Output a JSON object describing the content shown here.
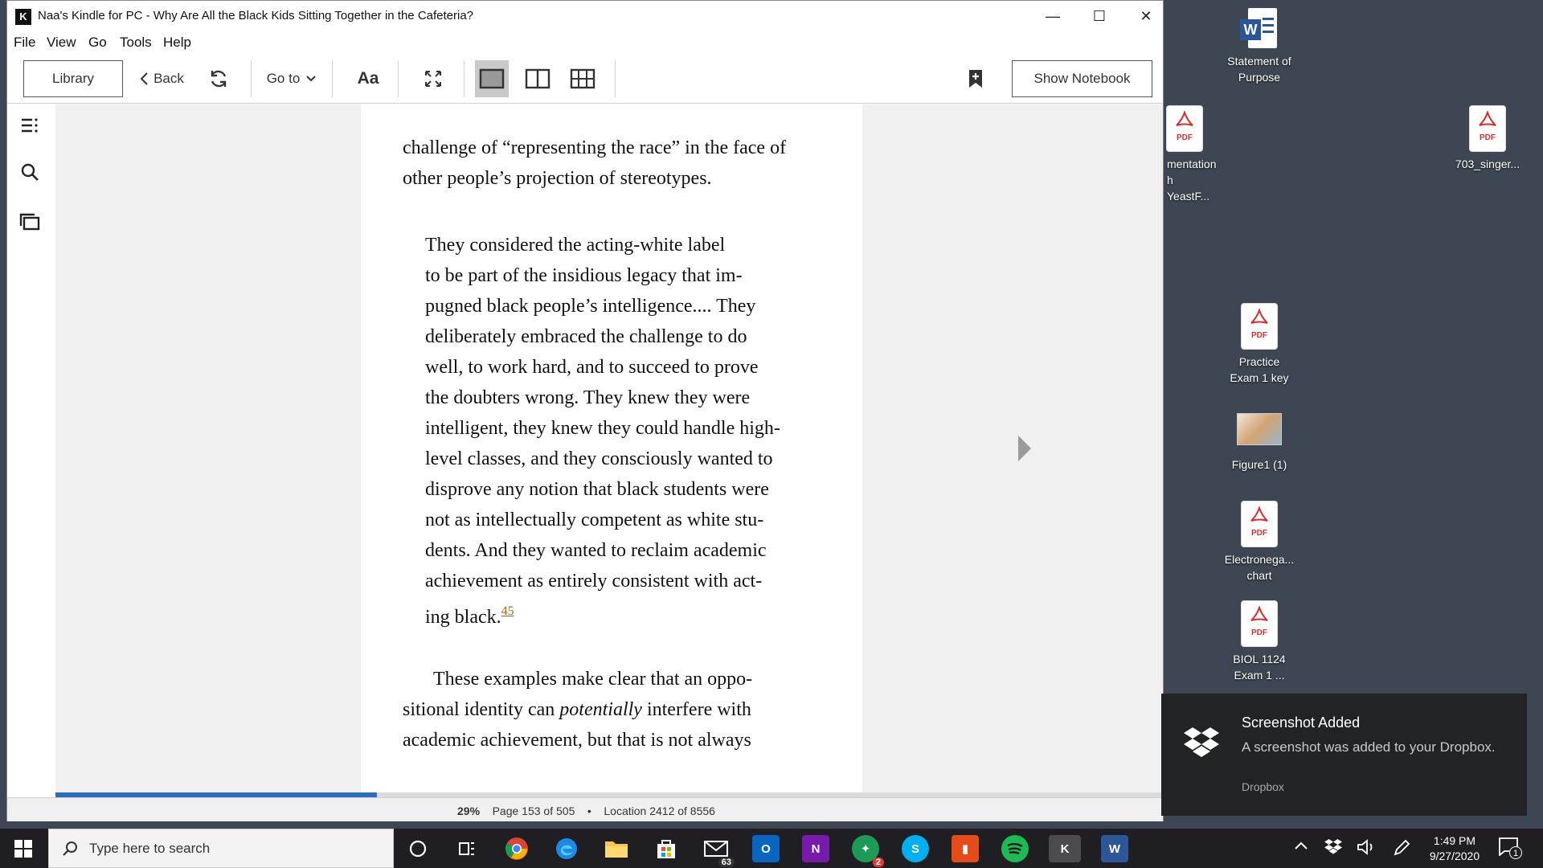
{
  "window": {
    "title": "Naa's Kindle for PC - Why Are All the Black Kids Sitting Together in the Cafeteria?",
    "app_logo": "K",
    "controls": {
      "minimize": "—",
      "maximize": "☐",
      "close": "✕"
    }
  },
  "menu": [
    "File",
    "View",
    "Go",
    "Tools",
    "Help"
  ],
  "toolbar": {
    "library": "Library",
    "back": "Back",
    "goto": "Go to",
    "font": "Aa",
    "show_notebook": "Show Notebook"
  },
  "book": {
    "p1": [
      "challenge of “representing the race” in the face of",
      "other people’s projection of stereotypes."
    ],
    "quote": [
      "They considered the acting-white label",
      "to be part of the insidious legacy that im-",
      "pugned black people’s intelligence.... They",
      "deliberately embraced the challenge to do",
      "well, to work hard, and to succeed to prove",
      "the doubters wrong. They knew they were",
      "intelligent, they knew they could handle high-",
      "level classes, and they consciously wanted to",
      "disprove any notion that black students were",
      "not as intellectually competent as white stu-",
      "dents. And they wanted to reclaim academic",
      "achievement as entirely consistent with act-"
    ],
    "quote_last": "ing black.",
    "footnote": "45",
    "p3_line1": "These examples make clear that an oppo-",
    "p3_line2_pre": "sitional identity can ",
    "p3_line2_em": "potentially",
    "p3_line2_post": " interfere with",
    "p3_line3": "academic achievement, but that is not always"
  },
  "status": {
    "percent": "29%",
    "page": "Page 153 of 505",
    "bullet": "•",
    "location": "Location 2412 of 8556",
    "progress_fraction": 0.29
  },
  "desktop": {
    "icons": [
      {
        "label1": "Statement of",
        "label2": "Purpose",
        "type": "word"
      },
      {
        "label1": "mentation",
        "label2": "h YeastF...",
        "type": "pdf"
      },
      {
        "label1": "703_singer...",
        "label2": "",
        "type": "pdf"
      },
      {
        "label1": "Practice",
        "label2": "Exam 1 key",
        "type": "pdf"
      },
      {
        "label1": "Figure1 (1)",
        "label2": "",
        "type": "image"
      },
      {
        "label1": "Electronega...",
        "label2": "chart",
        "type": "pdf"
      },
      {
        "label1": "BIOL 1124",
        "label2": "Exam 1 ...",
        "type": "pdf"
      }
    ],
    "pdf_tag": "PDF",
    "word_badge": "W"
  },
  "toast": {
    "title": "Screenshot Added",
    "message": "A screenshot was added to your Dropbox.",
    "source": "Dropbox"
  },
  "taskbar": {
    "search_placeholder": "Type here to search",
    "mail_badge": "63",
    "alert_badge": "2",
    "notification_count": "1",
    "time": "1:49 PM",
    "date": "9/27/2020"
  }
}
